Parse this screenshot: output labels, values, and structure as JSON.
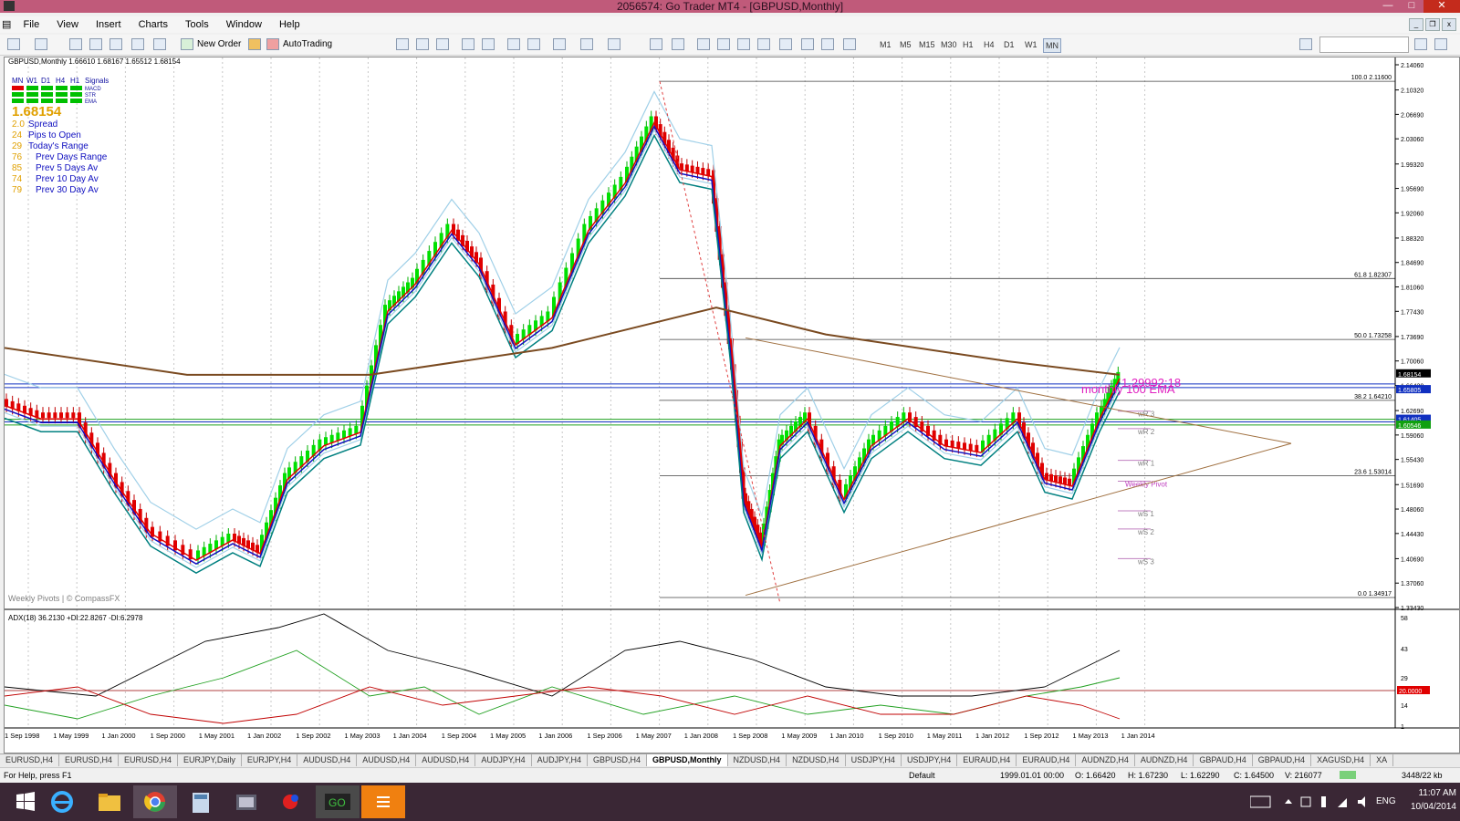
{
  "window": {
    "title": "2056574: Go Trader MT4 - [GBPUSD,Monthly]"
  },
  "menu": [
    "File",
    "View",
    "Insert",
    "Charts",
    "Tools",
    "Window",
    "Help"
  ],
  "toolbar": {
    "new_order": "New Order",
    "autotrading": "AutoTrading",
    "timeframes": [
      "M1",
      "M5",
      "M15",
      "M30",
      "H1",
      "H4",
      "D1",
      "W1",
      "MN"
    ],
    "active_timeframe": "MN"
  },
  "chart": {
    "header": "GBPUSD,Monthly  1.66610 1.68167 1.65512 1.68154",
    "signals": {
      "tfs": [
        "MN",
        "W1",
        "D1",
        "H4",
        "H1"
      ],
      "label": "Signals",
      "rows": [
        "MACD",
        "STR",
        "EMA"
      ],
      "colors": {
        "green": "#00c000",
        "red": "#e00000"
      }
    },
    "price": "1.68154",
    "info_rows": [
      {
        "value": "2.0",
        "label": "Spread"
      },
      {
        "value": "24",
        "label": "Pips to Open"
      },
      {
        "value": "29",
        "label": "Today's Range"
      },
      {
        "value": "76",
        "label": "Prev Days Range"
      },
      {
        "value": "85",
        "label": "Prev 5 Days Av"
      },
      {
        "value": "74",
        "label": "Prev 10 Day Av"
      },
      {
        "value": "79",
        "label": "Prev 30 Day Av"
      }
    ],
    "watermark": "Weekly Pivots | © CompassFX",
    "fib_levels": [
      {
        "label": "100.0 2.11600",
        "price": 2.116
      },
      {
        "label": "61.8 1.82307",
        "price": 1.82307
      },
      {
        "label": "50.0 1.73258",
        "price": 1.73258
      },
      {
        "label": "38.2 1.64210",
        "price": 1.6421
      },
      {
        "label": "23.6 1.53014",
        "price": 1.53014
      },
      {
        "label": "0.0 1.34917",
        "price": 1.34917
      }
    ],
    "price_axis": [
      "2.14060",
      "2.10320",
      "2.06690",
      "2.03060",
      "1.99320",
      "1.95690",
      "1.92060",
      "1.88320",
      "1.84690",
      "1.81060",
      "1.77430",
      "1.73690",
      "1.70060",
      "1.66430",
      "1.62690",
      "1.59060",
      "1.55430",
      "1.51690",
      "1.48060",
      "1.44430",
      "1.40690",
      "1.37060",
      "1.33430"
    ],
    "price_tags": [
      {
        "text": "1.68154",
        "price": 1.68154,
        "color": "#000000"
      },
      {
        "text": "1.65805",
        "price": 1.65805,
        "color": "#1030c0"
      },
      {
        "text": "1.61405",
        "price": 1.61405,
        "color": "#1030c0"
      },
      {
        "text": "1.60546",
        "price": 1.60546,
        "color": "#10a010"
      }
    ],
    "pivot_labels": [
      {
        "text": "wR 3",
        "price": 1.626
      },
      {
        "text": "wR 2",
        "price": 1.6
      },
      {
        "text": "wR 1",
        "price": 1.553
      },
      {
        "text": "Weekly Pivot",
        "price": 1.522
      },
      {
        "text": "wS 1",
        "price": 1.478
      },
      {
        "text": "wS 2",
        "price": 1.451
      },
      {
        "text": "wS 3",
        "price": 1.407
      }
    ],
    "magenta_text": "1.29992:18",
    "monthly_text": "monthly 100 EMA",
    "time_axis": [
      "1 Sep 1998",
      "1 May 1999",
      "1 Jan 2000",
      "1 Sep 2000",
      "1 May 2001",
      "1 Jan 2002",
      "1 Sep 2002",
      "1 May 2003",
      "1 Jan 2004",
      "1 Sep 2004",
      "1 May 2005",
      "1 Jan 2006",
      "1 Sep 2006",
      "1 May 2007",
      "1 Jan 2008",
      "1 Sep 2008",
      "1 May 2009",
      "1 Jan 2010",
      "1 Sep 2010",
      "1 May 2011",
      "1 Jan 2012",
      "1 Sep 2012",
      "1 May 2013",
      "1 Jan 2014"
    ],
    "adx_header": "ADX(18) 36.2130 +DI:22.8267 -DI:6.2978",
    "adx_axis": [
      "58",
      "43",
      "29",
      "20.0000",
      "14",
      "1"
    ]
  },
  "tabs": [
    "EURUSD,H4",
    "EURUSD,H4",
    "EURUSD,H4",
    "EURJPY,Daily",
    "EURJPY,H4",
    "AUDUSD,H4",
    "AUDUSD,H4",
    "AUDUSD,H4",
    "AUDJPY,H4",
    "AUDJPY,H4",
    "GBPUSD,H4",
    "GBPUSD,Monthly",
    "NZDUSD,H4",
    "NZDUSD,H4",
    "USDJPY,H4",
    "USDJPY,H4",
    "EURAUD,H4",
    "EURAUD,H4",
    "AUDNZD,H4",
    "AUDNZD,H4",
    "GBPAUD,H4",
    "GBPAUD,H4",
    "XAGUSD,H4",
    "XA"
  ],
  "active_tab": "GBPUSD,Monthly",
  "status": {
    "help": "For Help, press F1",
    "profile": "Default",
    "datetime": "1999.01.01 00:00",
    "open": "O: 1.66420",
    "high": "H: 1.67230",
    "low": "L: 1.62290",
    "close": "C: 1.64500",
    "volume": "V: 216077",
    "traffic": "3448/22 kb"
  },
  "taskbar": {
    "lang": "ENG",
    "time": "11:07 AM",
    "date": "10/04/2014"
  }
}
